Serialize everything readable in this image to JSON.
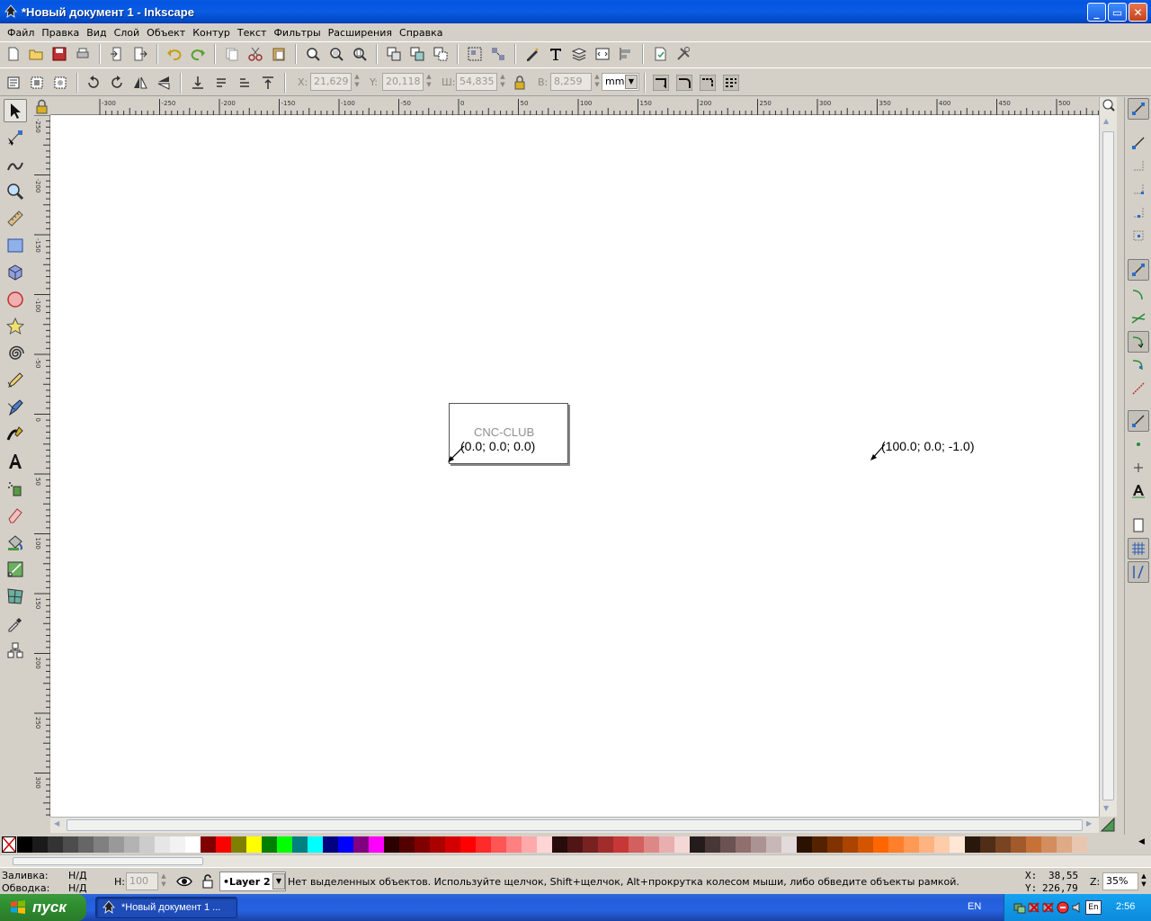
{
  "window": {
    "title": "*Новый документ 1 - Inkscape",
    "buttons": {
      "minimize": "_",
      "maximize": "▭",
      "close": "✕"
    }
  },
  "menu": [
    "Файл",
    "Правка",
    "Вид",
    "Слой",
    "Объект",
    "Контур",
    "Текст",
    "Фильтры",
    "Расширения",
    "Справка"
  ],
  "selector_toolbar": {
    "x_label": "X:",
    "x_value": "21,629",
    "y_label": "Y:",
    "y_value": "20,118",
    "w_label": "Ш:",
    "w_value": "54,835",
    "h_label": "В:",
    "h_value": "8,259",
    "unit": "mm"
  },
  "ruler": {
    "h_labels": [
      "-300",
      "-250",
      "-200",
      "-150",
      "-100",
      "-50",
      "0",
      "50",
      "100",
      "150",
      "200",
      "250",
      "300",
      "350",
      "400",
      "450",
      "500"
    ],
    "v_labels": [
      "-250",
      "-200",
      "-150",
      "-100",
      "-50",
      "0",
      "50",
      "100",
      "150",
      "200",
      "250",
      "300"
    ]
  },
  "canvas": {
    "label_box": {
      "title": "CNC-CLUB",
      "coords": "(0.0; 0.0; 0.0)"
    },
    "label_right": "(100.0; 0.0; -1.0)"
  },
  "palette_colors": [
    "#000000",
    "#1a1a1a",
    "#333333",
    "#4d4d4d",
    "#666666",
    "#808080",
    "#999999",
    "#b3b3b3",
    "#cccccc",
    "#e6e6e6",
    "#f2f2f2",
    "#ffffff",
    "#800000",
    "#ff0000",
    "#808000",
    "#ffff00",
    "#008000",
    "#00ff00",
    "#008080",
    "#00ffff",
    "#000080",
    "#0000ff",
    "#800080",
    "#ff00ff",
    "#2b0000",
    "#550000",
    "#800000",
    "#aa0000",
    "#d40000",
    "#ff0000",
    "#ff2a2a",
    "#ff5555",
    "#ff8080",
    "#ffaaaa",
    "#ffd5d5",
    "#280b0b",
    "#501616",
    "#782121",
    "#a02c2c",
    "#c83737",
    "#d35f5f",
    "#de8787",
    "#e9afaf",
    "#f4d7d7",
    "#241c1c",
    "#483737",
    "#6c5353",
    "#916f6f",
    "#ac9393",
    "#c8b7b7",
    "#e3dbdb",
    "#2b1100",
    "#552200",
    "#803300",
    "#aa4400",
    "#d45500",
    "#ff6600",
    "#ff7f2a",
    "#ff9955",
    "#ffb380",
    "#ffccaa",
    "#ffe6d5",
    "#28170b",
    "#502d16",
    "#784421",
    "#a05a2c",
    "#c87137",
    "#d38d5f",
    "#deaa87",
    "#e9c6af"
  ],
  "status": {
    "fill_label": "Заливка:",
    "fill_value": "Н/Д",
    "stroke_label": "Обводка:",
    "stroke_value": "Н/Д",
    "opacity_label": "Н:",
    "opacity_value": "100",
    "layer": "•Layer 2",
    "message": "Нет выделенных объектов. Используйте щелчок, Shift+щелчок, Alt+прокрутка колесом мыши, либо обведите объекты рамкой.",
    "cursor_x_label": "X:",
    "cursor_x": "38,55",
    "cursor_y_label": "Y:",
    "cursor_y": "226,79",
    "zoom_label": "Z:",
    "zoom": "35%"
  },
  "taskbar": {
    "start": "пуск",
    "task_title": "*Новый документ 1 ...",
    "lang": "EN",
    "lang_icon": "En",
    "clock": "2:56"
  }
}
